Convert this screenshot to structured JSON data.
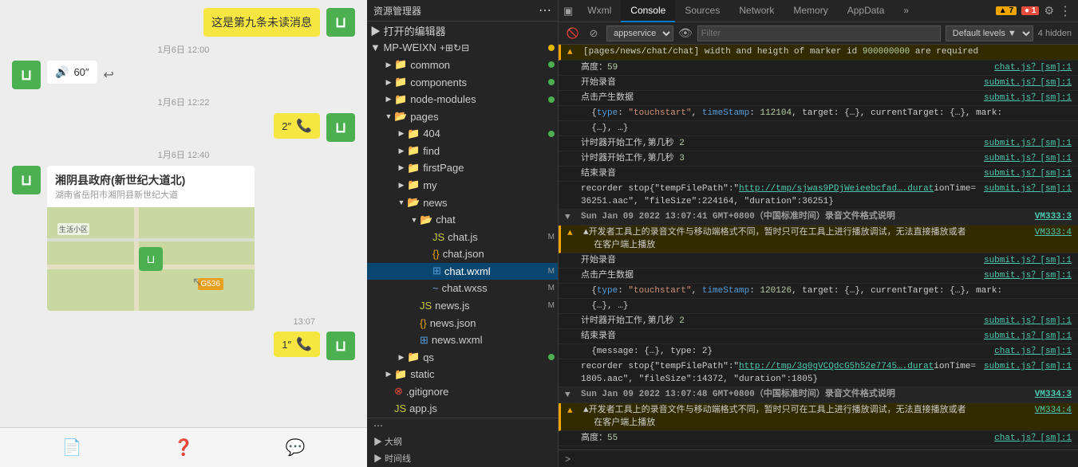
{
  "chat": {
    "messages": [
      {
        "id": 1,
        "type": "bubble-right",
        "text": "这是第九条未读消息",
        "style": "yellow"
      },
      {
        "id": 2,
        "type": "timestamp",
        "text": "1月6日 12:00"
      },
      {
        "id": 3,
        "type": "voice-left",
        "duration": "60″",
        "has_reply": true
      },
      {
        "id": 4,
        "type": "timestamp",
        "text": "1月6日 12:22"
      },
      {
        "id": 5,
        "type": "voice-right",
        "duration": "2″",
        "has_phone": true
      },
      {
        "id": 6,
        "type": "timestamp",
        "text": "1月6日 12:40"
      },
      {
        "id": 7,
        "type": "map-left",
        "title": "湘阴县政府(新世纪大道北)",
        "subtitle": "湖南省岳阳市湘阴县新世纪大道"
      },
      {
        "id": 8,
        "type": "timestamp-right",
        "text": "13:07"
      },
      {
        "id": 9,
        "type": "voice-right",
        "duration": "1″",
        "has_phone": true
      }
    ],
    "bottom_icons": [
      "file",
      "question",
      "chat"
    ]
  },
  "explorer": {
    "title": "资源管理器",
    "open_editors_label": "▶ 打开的编辑器",
    "mp_weixn_label": "▼ MP-WEIXN",
    "folders": [
      {
        "name": "common",
        "indent": 1,
        "type": "folder",
        "badge": ""
      },
      {
        "name": "components",
        "indent": 1,
        "type": "folder",
        "badge": ""
      },
      {
        "name": "node-modules",
        "indent": 1,
        "type": "folder",
        "badge": ""
      },
      {
        "name": "pages",
        "indent": 1,
        "type": "folder-open",
        "badge": ""
      },
      {
        "name": "404",
        "indent": 2,
        "type": "folder",
        "badge": ""
      },
      {
        "name": "find",
        "indent": 2,
        "type": "folder",
        "badge": ""
      },
      {
        "name": "firstPage",
        "indent": 2,
        "type": "folder",
        "badge": ""
      },
      {
        "name": "my",
        "indent": 2,
        "type": "folder",
        "badge": ""
      },
      {
        "name": "news",
        "indent": 2,
        "type": "folder-open",
        "badge": ""
      },
      {
        "name": "chat",
        "indent": 3,
        "type": "folder-open",
        "badge": ""
      },
      {
        "name": "chat.js",
        "indent": 4,
        "type": "js",
        "badge": "M"
      },
      {
        "name": "chat.json",
        "indent": 4,
        "type": "json",
        "badge": ""
      },
      {
        "name": "chat.wxml",
        "indent": 4,
        "type": "wxml",
        "badge": "M",
        "active": true
      },
      {
        "name": "chat.wxss",
        "indent": 4,
        "type": "wxss",
        "badge": "M"
      },
      {
        "name": "news.js",
        "indent": 3,
        "type": "js",
        "badge": "M"
      },
      {
        "name": "news.json",
        "indent": 3,
        "type": "json",
        "badge": ""
      },
      {
        "name": "news.wxml",
        "indent": 3,
        "type": "wxml",
        "badge": ""
      },
      {
        "name": "qs",
        "indent": 2,
        "type": "folder",
        "badge": ""
      },
      {
        "name": "static",
        "indent": 1,
        "type": "folder",
        "badge": ""
      },
      {
        "name": ".gitignore",
        "indent": 1,
        "type": "git",
        "badge": ""
      },
      {
        "name": "app.js",
        "indent": 1,
        "type": "js",
        "badge": ""
      }
    ],
    "outline_label": "▶ 大纲",
    "timeline_label": "▶ 时间线"
  },
  "devtools": {
    "tabs": [
      "Wxml",
      "Console",
      "Sources",
      "Network",
      "Memory",
      "AppData"
    ],
    "active_tab": "Console",
    "more_tabs": "»",
    "badge_warning": "▲ 7",
    "badge_error": "● 1",
    "toolbar": {
      "appservice_label": "appservice",
      "filter_placeholder": "Filter",
      "levels_label": "Default levels ▼",
      "hidden_count": "4 hidden"
    },
    "console_entries": [
      {
        "type": "warning",
        "icon": "▲",
        "text": "[pages/news/chat/chat] width and heigth of marker id 900000000 are required",
        "source": ""
      },
      {
        "type": "info",
        "text": "高度：59",
        "source": "chat.js？[sm]:1"
      },
      {
        "type": "info",
        "text": "开始录音",
        "source": "submit.js？[sm]:1"
      },
      {
        "type": "info",
        "text": "点击产生数据",
        "source": "submit.js？[sm]:1"
      },
      {
        "type": "info",
        "text": "  {type: \"touchstart\", timeStamp: 112104, target: {…}, currentTarget: {…}, mark:",
        "source": ""
      },
      {
        "type": "info",
        "text": "  {…}, …}",
        "source": ""
      },
      {
        "type": "info",
        "text": "计时器开始工作,第几秒 2",
        "source": "submit.js？[sm]:1"
      },
      {
        "type": "info",
        "text": "计时器开始工作,第几秒 3",
        "source": "submit.js？[sm]:1"
      },
      {
        "type": "info",
        "text": "结束录音",
        "source": "submit.js？[sm]:1"
      },
      {
        "type": "info",
        "text": "recorder stop{\"tempFilePath\":\"http://tmp/sjwas9PDjWeieebcfad….durationTime=36251.aac\", \"fileSize\":224164, \"duration\":36251}",
        "source": "submit.js？[sm]:1"
      },
      {
        "type": "section",
        "text": "▼ Sun Jan 09 2022 13:07:41 GMT+0800（中国标准时间）录音文件格式说明",
        "source": "VM333:3"
      },
      {
        "type": "warning",
        "icon": "▲",
        "text": "▲开发者工具上的录音文件与移动端格式不同，暂时只可在工具上进行播放调试，无法直接播放或者在客户端上播放",
        "source": "VM333:4"
      },
      {
        "type": "info",
        "text": "开始录音",
        "source": "submit.js？[sm]:1"
      },
      {
        "type": "info",
        "text": "点击产生数据",
        "source": "submit.js？[sm]:1"
      },
      {
        "type": "info",
        "text": "  {type: \"touchstart\", timeStamp: 120126, target: {…}, currentTarget: {…}, mark:",
        "source": ""
      },
      {
        "type": "info",
        "text": "  {…}, …}",
        "source": ""
      },
      {
        "type": "info",
        "text": "计时器开始工作,第几秒 2",
        "source": "submit.js？[sm]:1"
      },
      {
        "type": "info",
        "text": "结束录音",
        "source": "submit.js？[sm]:1"
      },
      {
        "type": "info",
        "text": "  {message: {…}, type: 2}",
        "source": "chat.js？[sm]:1"
      },
      {
        "type": "info",
        "text": "recorder stop{\"tempFilePath\":\"http://tmp/3q0gVCQdcG5h52e7745….durationTime=1805.aac\", \"fileSize\":14372, \"duration\":1805}",
        "source": "submit.js？[sm]:1"
      },
      {
        "type": "section",
        "text": "▼ Sun Jan 09 2022 13:07:48 GMT+0800（中国标准时间）录音文件格式说明",
        "source": "VM334:3"
      },
      {
        "type": "warning",
        "icon": "▲",
        "text": "▲开发者工具上的录音文件与移动端格式不同，暂时只可在工具上进行播放调试，无法直接播放或者在客户端上播放",
        "source": "VM334:4"
      },
      {
        "type": "info",
        "text": "高度：55",
        "source": "chat.js？[sm]:1"
      }
    ]
  }
}
